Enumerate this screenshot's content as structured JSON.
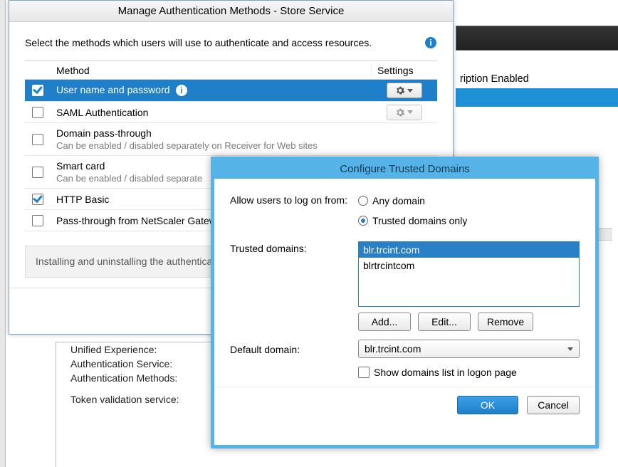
{
  "bg": {
    "sub_enabled_label": "ription Enabled",
    "props": {
      "unified": "Unified Experience:",
      "auth_service": "Authentication Service:",
      "auth_methods": "Authentication Methods:",
      "token": "Token validation service:"
    }
  },
  "auth": {
    "title": "Manage Authentication Methods - Store Service",
    "intro": "Select the methods which users will use to authenticate and access resources.",
    "headers": {
      "method": "Method",
      "settings": "Settings"
    },
    "rows": [
      {
        "label": "User name and password",
        "checked": true,
        "selected": true,
        "has_gear": true,
        "gear_enabled": true
      },
      {
        "label": "SAML Authentication",
        "checked": false,
        "has_gear": true,
        "gear_enabled": false
      },
      {
        "label": "Domain pass-through",
        "sub": "Can be enabled / disabled separately on Receiver for Web sites",
        "checked": false
      },
      {
        "label": "Smart card",
        "sub": "Can be enabled / disabled separate",
        "checked": false
      },
      {
        "label": "HTTP Basic",
        "checked": true
      },
      {
        "label": "Pass-through from NetScaler Gatew",
        "checked": false
      }
    ],
    "note": "Installing and uninstalling the authentication  ...\nauthentication service settings are includ"
  },
  "td": {
    "title": "Configure Trusted Domains",
    "allow_label": "Allow users to log on from:",
    "any_label": "Any domain",
    "only_label": "Trusted domains only",
    "selected_option": "only",
    "trusted_label": "Trusted domains:",
    "domains": [
      {
        "text": "blr.trcint.com",
        "selected": true
      },
      {
        "text": "blrtrcintcom",
        "selected": false
      }
    ],
    "add": "Add...",
    "edit": "Edit...",
    "remove": "Remove",
    "default_label": "Default domain:",
    "default_value": "blr.trcint.com",
    "show_list": "Show domains list in logon page",
    "show_list_checked": false,
    "ok": "OK",
    "cancel": "Cancel"
  }
}
